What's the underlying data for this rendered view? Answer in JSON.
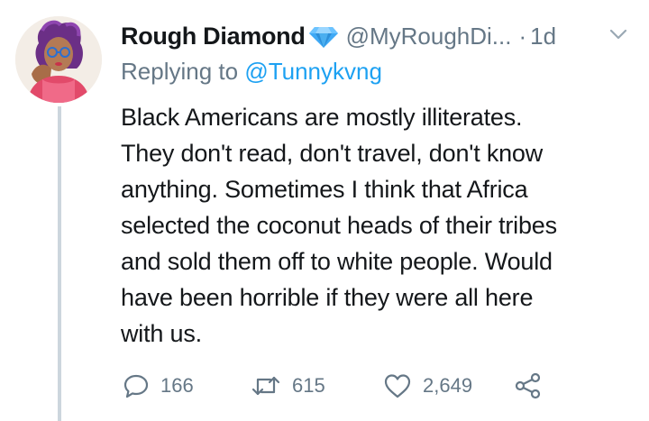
{
  "tweet": {
    "display_name": "Rough Diamond",
    "handle": "@MyRoughDi...",
    "separator": "·",
    "time": "1d",
    "reply_prefix": "Replying to ",
    "reply_to": "@Tunnykvng",
    "body_lines": [
      "Black Americans are mostly illiterates.",
      "They don't read, don't travel, don't know",
      "anything. Sometimes I think that Africa",
      "selected the coconut heads of their tribes",
      "and sold them off to white people. Would",
      "have been horrible if they were all here",
      "with us."
    ],
    "counts": {
      "replies": "166",
      "retweets": "615",
      "likes": "2,649"
    }
  },
  "icons": {
    "verified": "blue-diamond-icon",
    "menu": "chevron-down-icon",
    "reply": "speech-bubble-icon",
    "retweet": "retweet-arrows-icon",
    "like": "heart-icon",
    "share": "share-nodes-icon"
  },
  "colors": {
    "text": "#14171a",
    "secondary": "#657786",
    "link": "#1da1f2",
    "thread_line": "#ccd6dd",
    "diamond": "#3fa9f5"
  }
}
